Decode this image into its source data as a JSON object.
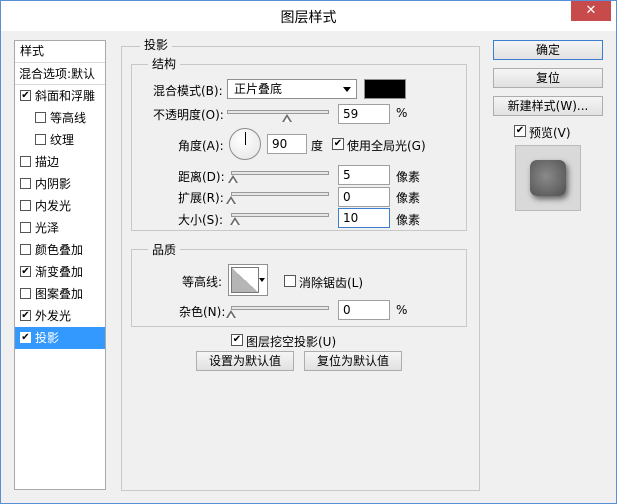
{
  "window": {
    "title": "图层样式",
    "close": "✕"
  },
  "left_list": {
    "header": "样式",
    "items": [
      {
        "label": "混合选项:默认",
        "checkbox": null,
        "indent": false,
        "selected": false
      },
      {
        "label": "斜面和浮雕",
        "checkbox": true,
        "indent": false,
        "selected": false
      },
      {
        "label": "等高线",
        "checkbox": false,
        "indent": true,
        "selected": false
      },
      {
        "label": "纹理",
        "checkbox": false,
        "indent": true,
        "selected": false
      },
      {
        "label": "描边",
        "checkbox": false,
        "indent": false,
        "selected": false
      },
      {
        "label": "内阴影",
        "checkbox": false,
        "indent": false,
        "selected": false
      },
      {
        "label": "内发光",
        "checkbox": false,
        "indent": false,
        "selected": false
      },
      {
        "label": "光泽",
        "checkbox": false,
        "indent": false,
        "selected": false
      },
      {
        "label": "颜色叠加",
        "checkbox": false,
        "indent": false,
        "selected": false
      },
      {
        "label": "渐变叠加",
        "checkbox": true,
        "indent": false,
        "selected": false
      },
      {
        "label": "图案叠加",
        "checkbox": false,
        "indent": false,
        "selected": false
      },
      {
        "label": "外发光",
        "checkbox": true,
        "indent": false,
        "selected": false
      },
      {
        "label": "投影",
        "checkbox": true,
        "indent": false,
        "selected": true
      }
    ]
  },
  "panel": {
    "title": "投影",
    "structure": {
      "title": "结构",
      "blend_mode_label": "混合模式(B):",
      "blend_mode_value": "正片叠底",
      "shadow_color": "#000000",
      "opacity_label": "不透明度(O):",
      "opacity_value": "59",
      "opacity_fraction": 0.59,
      "percent": "%",
      "angle_label": "角度(A):",
      "angle_value": "90",
      "angle_unit": "度",
      "global_light_label": "使用全局光(G)",
      "global_light_checked": true,
      "distance_label": "距离(D):",
      "distance_value": "5",
      "distance_fraction": 0.02,
      "spread_label": "扩展(R):",
      "spread_value": "0",
      "spread_fraction": 0.0,
      "size_label": "大小(S):",
      "size_value": "10",
      "size_fraction": 0.04,
      "pixel_unit": "像素"
    },
    "quality": {
      "title": "品质",
      "contour_label": "等高线:",
      "antialias_label": "消除锯齿(L)",
      "antialias_checked": false,
      "noise_label": "杂色(N):",
      "noise_value": "0",
      "noise_fraction": 0.0
    },
    "knockout_label": "图层挖空投影(U)",
    "knockout_checked": true,
    "set_default_label": "设置为默认值",
    "reset_default_label": "复位为默认值"
  },
  "right": {
    "ok_label": "确定",
    "reset_label": "复位",
    "new_style_label": "新建样式(W)...",
    "preview_label": "预览(V)",
    "preview_checked": true
  }
}
